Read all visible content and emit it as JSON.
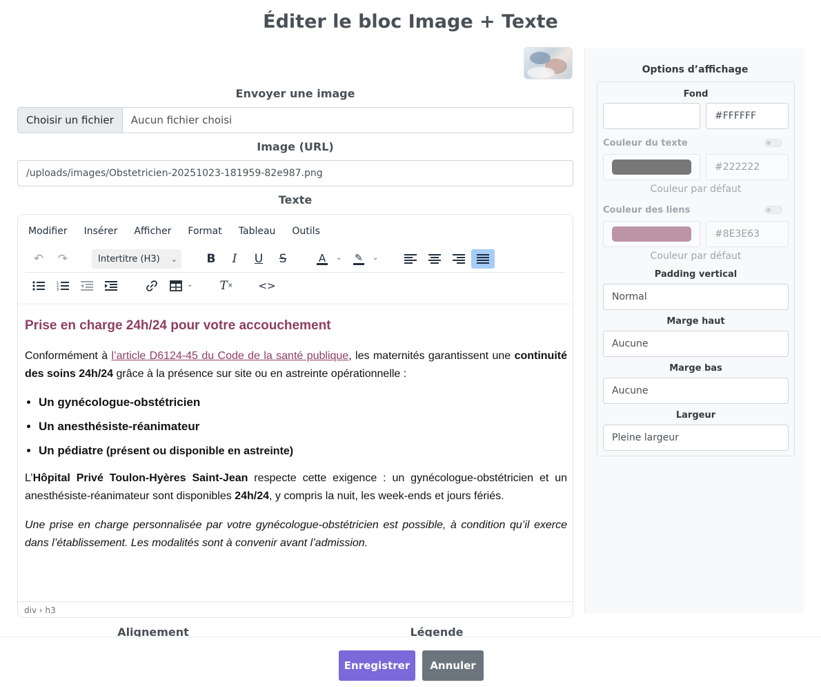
{
  "modal": {
    "title": "Éditer le bloc Image + Texte"
  },
  "upload": {
    "label": "Envoyer une image",
    "choose_button": "Choisir un fichier",
    "no_file": "Aucun fichier choisi"
  },
  "image_url": {
    "label": "Image (URL)",
    "value": "/uploads/images/Obstetricien-20251023-181959-82e987.png"
  },
  "text_field": {
    "label": "Texte"
  },
  "editor": {
    "menu": [
      "Modifier",
      "Insérer",
      "Afficher",
      "Format",
      "Tableau",
      "Outils"
    ],
    "block_format": "Intertitre (H3)",
    "statusbar_path": "div › h3",
    "content": {
      "heading": "Prise en charge 24h/24 pour votre accouchement",
      "p1_before": "Conformément à ",
      "p1_link": "l’article D6124-45 du Code de la santé publique",
      "p1_mid": ", les maternités garantissent une ",
      "p1_bold": "continuité des soins 24h/24",
      "p1_after": " grâce à la présence sur site ou en astreinte opérationnelle :",
      "list": [
        {
          "prefix": "Un ",
          "bold": "gynécologue-obstétricien",
          "suffix": ""
        },
        {
          "prefix": "Un ",
          "bold": "anesthésiste-réanimateur",
          "suffix": ""
        },
        {
          "prefix": "Un ",
          "bold": "pédiatre",
          "suffix": " (présent ou disponible en astreinte)"
        }
      ],
      "p2_before": "L’",
      "p2_bold": "Hôpital Privé Toulon-Hyères Saint-Jean",
      "p2_mid": " respecte cette exigence : un gynécologue-obstétricien et un anesthésiste-réanimateur sont disponibles ",
      "p2_bold2": "24h/24",
      "p2_after": ", y compris la nuit, les week-ends et jours fériés.",
      "p3_italic": "Une prise en charge personnalisée par votre gynécologue-obstétricien est possible, à condition qu’il exerce dans l’établissement. Les modalités sont à convenir avant l’admission."
    }
  },
  "options": {
    "title": "Options d’affichage",
    "background": {
      "label": "Fond",
      "hex": "#FFFFFF",
      "color": "#FFFFFF"
    },
    "text_color": {
      "label": "Couleur du texte",
      "hex": "#222222",
      "swatch": "#777777",
      "hint": "Couleur par défaut"
    },
    "link_color": {
      "label": "Couleur des liens",
      "hex": "#8E3E63",
      "swatch": "#BC94A6",
      "hint": "Couleur par défaut"
    },
    "padding": {
      "label": "Padding vertical",
      "value": "Normal"
    },
    "margin_top": {
      "label": "Marge haut",
      "value": "Aucune"
    },
    "margin_bottom": {
      "label": "Marge bas",
      "value": "Aucune"
    },
    "width": {
      "label": "Largeur",
      "value": "Pleine largeur"
    }
  },
  "below": {
    "alignment_label": "Alignement",
    "caption_label": "Légende"
  },
  "footer": {
    "save_label": "Enregistrer",
    "cancel_label": "Annuler",
    "save_color": "#7B68D9",
    "cancel_color": "#6C757D"
  }
}
